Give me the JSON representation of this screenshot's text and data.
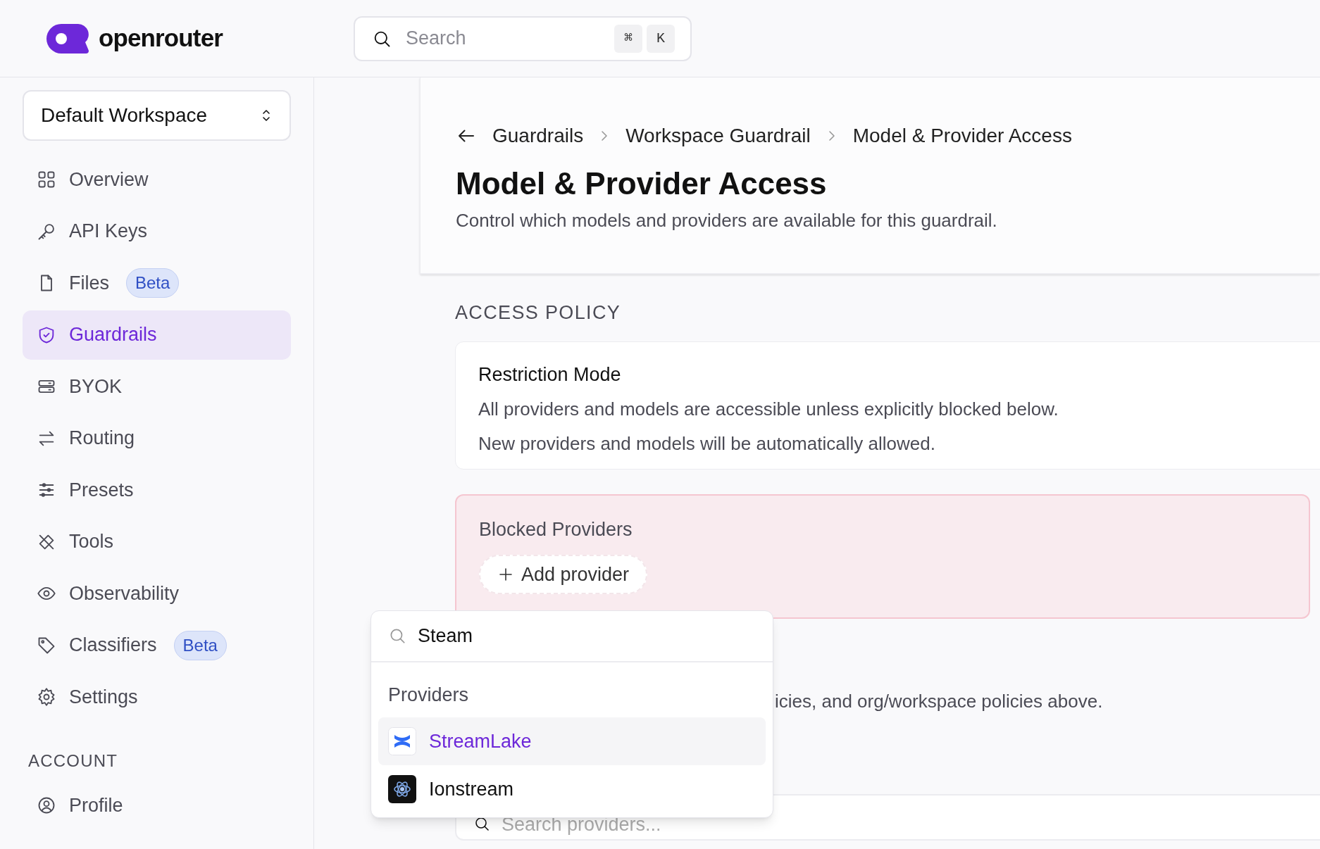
{
  "logo": {
    "text": "openrouter"
  },
  "search": {
    "placeholder": "Search",
    "keys": [
      "⌘",
      "K"
    ]
  },
  "workspace": {
    "label": "Default Workspace"
  },
  "nav": [
    {
      "label": "Overview",
      "selected": false
    },
    {
      "label": "API Keys",
      "selected": false
    },
    {
      "label": "Files",
      "badge": "Beta",
      "selected": false
    },
    {
      "label": "Guardrails",
      "selected": true
    },
    {
      "label": "BYOK",
      "selected": false
    },
    {
      "label": "Routing",
      "selected": false
    },
    {
      "label": "Presets",
      "selected": false
    },
    {
      "label": "Tools",
      "selected": false
    },
    {
      "label": "Observability",
      "selected": false
    },
    {
      "label": "Classifiers",
      "badge": "Beta",
      "selected": false
    },
    {
      "label": "Settings",
      "selected": false
    }
  ],
  "account": {
    "heading": "ACCOUNT",
    "items": [
      {
        "label": "Profile",
        "selected": false
      }
    ]
  },
  "breadcrumb": [
    "Guardrails",
    "Workspace Guardrail",
    "Model & Provider Access"
  ],
  "page": {
    "title": "Model & Provider Access",
    "subtitle": "Control which models and providers are available for this guardrail."
  },
  "section_heading": "ACCESS POLICY",
  "restriction": {
    "title": "Restriction Mode",
    "lines": [
      "All providers and models are accessible unless explicitly blocked below.",
      "New providers and models will be automatically allowed."
    ]
  },
  "blocked": {
    "title": "Blocked Providers",
    "add_button": "Add provider"
  },
  "note": "icies, and org/workspace policies above.",
  "provider_search": {
    "placeholder": "Search providers..."
  },
  "dropdown": {
    "query": "Steam",
    "group": "Providers",
    "items": [
      {
        "label": "StreamLake",
        "selected": true
      },
      {
        "label": "Ionstream",
        "selected": false
      }
    ]
  }
}
